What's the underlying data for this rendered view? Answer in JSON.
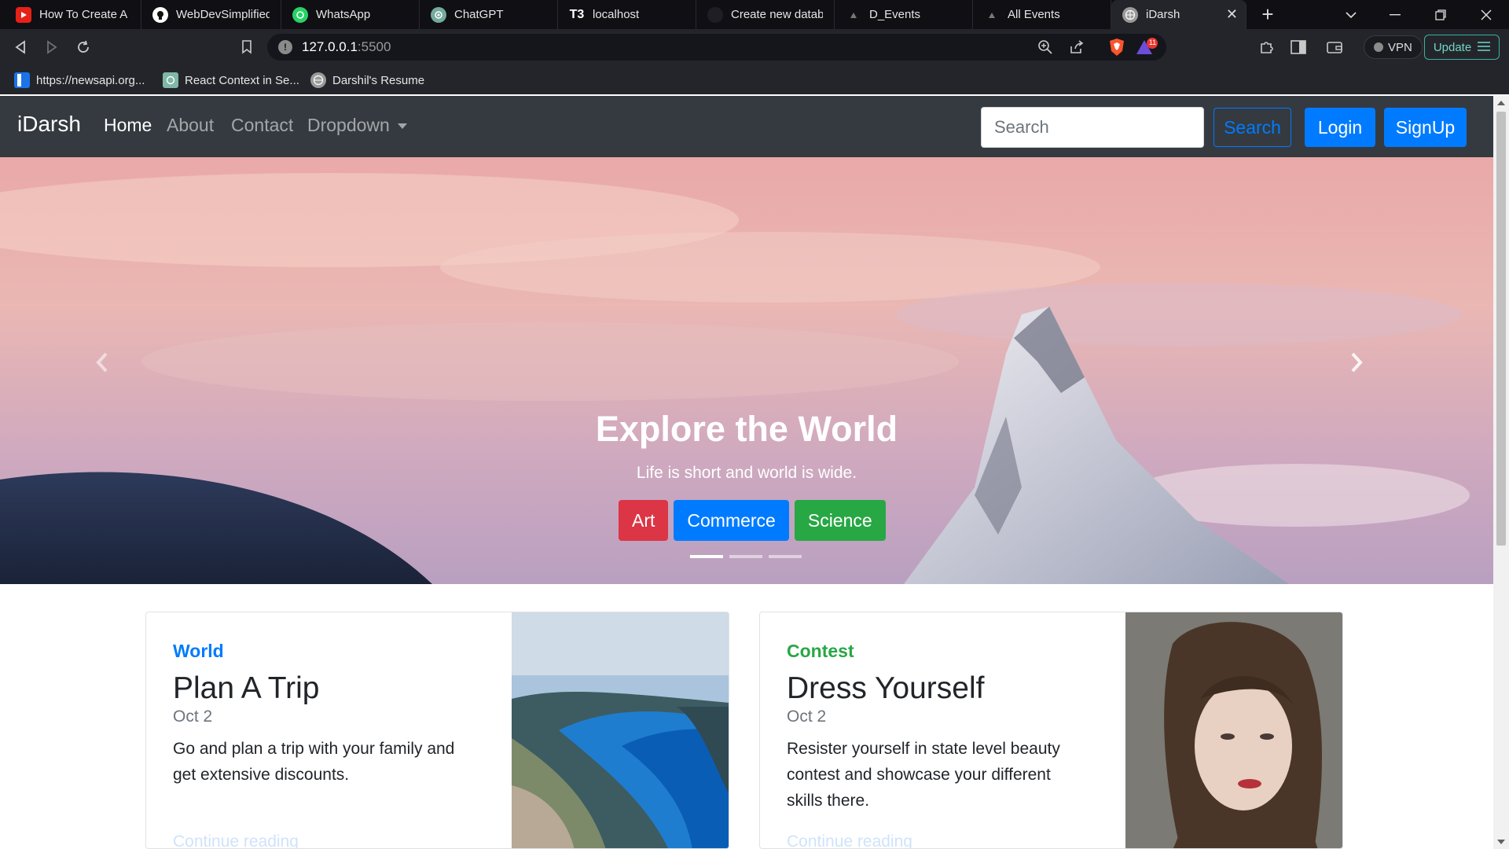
{
  "tabs": [
    {
      "title": "How To Create A S",
      "icon": "youtube-icon",
      "fav_color": "#e62117"
    },
    {
      "title": "WebDevSimplified/",
      "icon": "github-icon",
      "fav_color": "#ffffff"
    },
    {
      "title": "WhatsApp",
      "icon": "whatsapp-icon",
      "fav_color": "#25d366"
    },
    {
      "title": "ChatGPT",
      "icon": "chatgpt-icon",
      "fav_color": "#74aa9c"
    },
    {
      "title": "localhost",
      "icon": "t3-icon",
      "fav_color": "#0f0f14"
    },
    {
      "title": "Create new databa",
      "icon": "vercel-icon",
      "fav_color": "#1e1e24"
    },
    {
      "title": "D_Events",
      "icon": "vercel-icon",
      "fav_color": "#1e1e24"
    },
    {
      "title": "All Events",
      "icon": "vercel-icon",
      "fav_color": "#1e1e24"
    },
    {
      "title": "iDarsh",
      "icon": "globe-icon",
      "fav_color": "#9a9a9a",
      "active": true
    }
  ],
  "url": {
    "host": "127.0.0.1",
    "port": ":5500"
  },
  "toolbar": {
    "vpn_label": "VPN",
    "update_label": "Update",
    "brave_badge": "11"
  },
  "bookmarks": [
    {
      "label": "https://newsapi.org...",
      "icon": "newsapi-icon"
    },
    {
      "label": "React Context in Se...",
      "icon": "react-icon"
    },
    {
      "label": "Darshil's Resume",
      "icon": "globe-icon"
    }
  ],
  "navbar": {
    "brand": "iDarsh",
    "links": [
      "Home",
      "About",
      "Contact",
      "Dropdown"
    ],
    "search_placeholder": "Search",
    "search_button": "Search",
    "login": "Login",
    "signup": "SignUp"
  },
  "carousel": {
    "title": "Explore the World",
    "subtitle": "Life is short and world is wide.",
    "buttons": [
      {
        "label": "Art",
        "color": "#dc3545"
      },
      {
        "label": "Commerce",
        "color": "#007bff"
      },
      {
        "label": "Science",
        "color": "#28a745"
      }
    ],
    "active_slide": 1,
    "slide_count": 3
  },
  "cards": [
    {
      "category": "World",
      "category_color": "#007bff",
      "title": "Plan A Trip",
      "date": "Oct 2",
      "text_lines": [
        "Go and plan a trip with your family and",
        "get extensive discounts."
      ],
      "more": "Continue reading"
    },
    {
      "category": "Contest",
      "category_color": "#28a745",
      "title": "Dress Yourself",
      "date": "Oct 2",
      "text_lines": [
        "Resister yourself in state level beauty",
        "contest and showcase your different",
        "skills there."
      ],
      "more": "Continue reading"
    }
  ],
  "colors": {
    "navbar": "#343a40",
    "primary": "#007bff"
  }
}
